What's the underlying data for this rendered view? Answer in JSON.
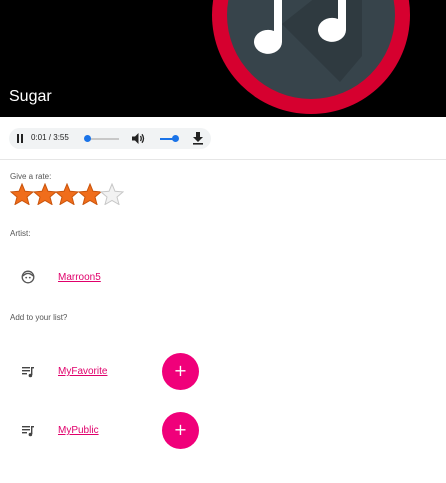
{
  "track": {
    "title": "Sugar",
    "art_icon": "music-note-icon",
    "art_colors": {
      "ring": "#d6002f",
      "disc": "#37444b",
      "note": "#ffffff"
    }
  },
  "player": {
    "state": "playing",
    "time": "0:01 / 3:55",
    "progress": 0.004,
    "volume": 0.7,
    "icons": [
      "pause-icon",
      "volume-icon",
      "download-icon"
    ]
  },
  "rating": {
    "label": "Give a rate:",
    "value": 4,
    "max": 5,
    "star_color": "#f06d1b"
  },
  "artist": {
    "label": "Artist:",
    "name": "Marroon5",
    "icon": "face-icon"
  },
  "lists": {
    "label": "Add to your list?",
    "items": [
      {
        "name": "MyFavorite",
        "icon": "playlist-icon",
        "add_label": "+"
      },
      {
        "name": "MyPublic",
        "icon": "playlist-icon",
        "add_label": "+"
      }
    ]
  },
  "colors": {
    "accent": "#f0007a",
    "link": "#e0006b",
    "player_accent": "#1a73e8"
  }
}
